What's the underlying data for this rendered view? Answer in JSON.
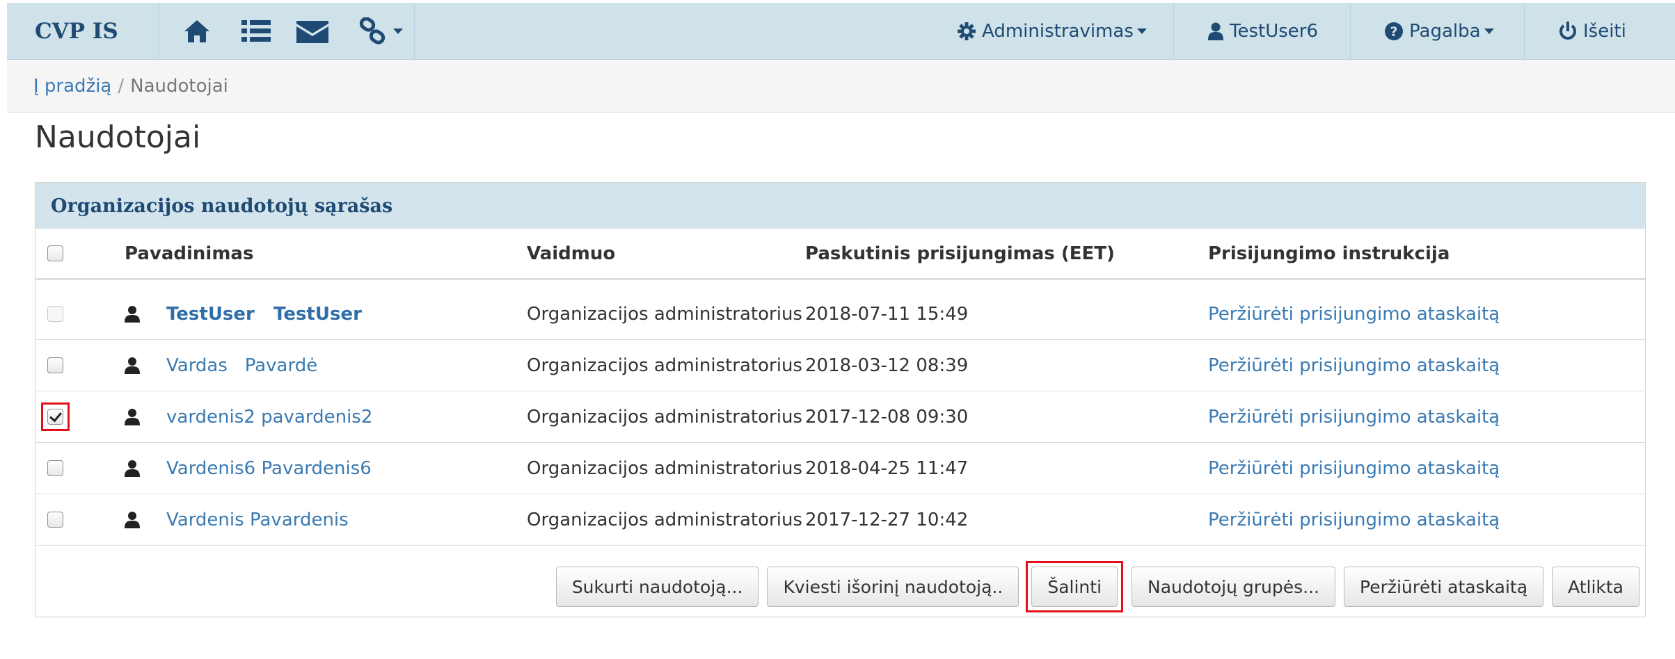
{
  "navbar": {
    "brand": "CVP IS",
    "icons": [
      "home-icon",
      "list-icon",
      "envelope-icon",
      "link-icon"
    ],
    "admin_label": "Administravimas",
    "user_label": "TestUser6",
    "help_label": "Pagalba",
    "logout_label": "Išeiti"
  },
  "breadcrumb": {
    "home": "Į pradžią",
    "separator": "/",
    "current": "Naudotojai"
  },
  "page_title": "Naudotojai",
  "panel": {
    "title": "Organizacijos naudotojų sąrašas",
    "columns": {
      "name": "Pavadinimas",
      "role": "Vaidmuo",
      "last_login": "Paskutinis prisijungimas (EET)",
      "instructions": "Prisijungimo instrukcija"
    },
    "rows": [
      {
        "first": "TestUser",
        "last": "TestUser",
        "role": "Organizacijos administratorius",
        "last_login": "2018-07-11 15:49",
        "instruction": "Peržiūrėti prisijungimo ataskaitą"
      },
      {
        "first": "Vardas",
        "last": "Pavardė",
        "role": "Organizacijos administratorius",
        "last_login": "2018-03-12 08:39",
        "instruction": "Peržiūrėti prisijungimo ataskaitą"
      },
      {
        "first": "vardenis2",
        "last": "pavardenis2",
        "role": "Organizacijos administratorius",
        "last_login": "2017-12-08 09:30",
        "instruction": "Peržiūrėti prisijungimo ataskaitą"
      },
      {
        "first": "Vardenis6",
        "last": "Pavardenis6",
        "role": "Organizacijos administratorius",
        "last_login": "2018-04-25 11:47",
        "instruction": "Peržiūrėti prisijungimo ataskaitą"
      },
      {
        "first": "Vardenis",
        "last": "Pavardenis",
        "role": "Organizacijos administratorius",
        "last_login": "2017-12-27 10:42",
        "instruction": "Peržiūrėti prisijungimo ataskaitą"
      }
    ]
  },
  "buttons": {
    "create": "Sukurti naudotoją...",
    "invite": "Kviesti išorinį naudotoją..",
    "delete": "Šalinti",
    "groups": "Naudotojų grupės...",
    "report": "Peržiūrėti ataskaitą",
    "done": "Atlikta"
  },
  "colors": {
    "navbar_bg": "#cfe2ea",
    "brand": "#1f4a73",
    "link": "#3a7ab2",
    "highlight": "#e3101c"
  }
}
